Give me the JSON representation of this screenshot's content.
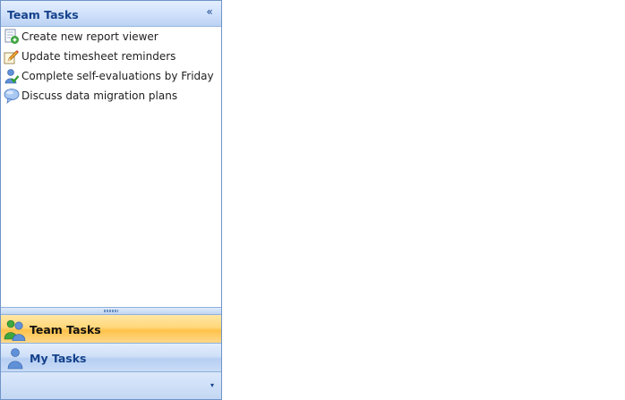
{
  "header": {
    "title": "Team Tasks",
    "collapse_icon": "double-chevron-left-icon",
    "collapse_glyph": "«"
  },
  "tasks": [
    {
      "label": "Create new report viewer",
      "icon": "new-report-icon"
    },
    {
      "label": "Update timesheet reminders",
      "icon": "pencil-edit-icon"
    },
    {
      "label": "Complete self-evaluations by Friday",
      "icon": "user-check-icon"
    },
    {
      "label": "Discuss data migration plans",
      "icon": "speech-bubble-icon"
    }
  ],
  "groups": [
    {
      "label": "Team Tasks",
      "icon": "team-users-icon",
      "selected": true
    },
    {
      "label": "My Tasks",
      "icon": "user-icon",
      "selected": false
    }
  ],
  "footer": {
    "more_icon": "chevron-down-icon",
    "more_glyph": "▾"
  },
  "colors": {
    "header_text": "#15428b",
    "border": "#6f94c8",
    "selected_group": "#ffc24a"
  }
}
